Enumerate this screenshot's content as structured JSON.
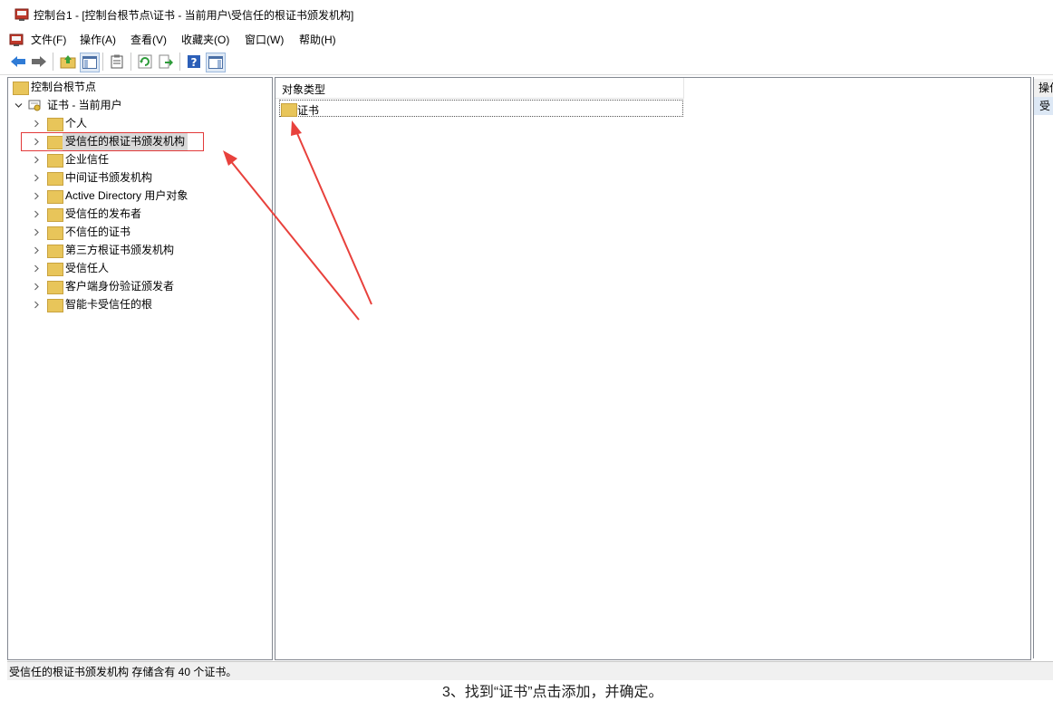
{
  "window": {
    "title": "控制台1 - [控制台根节点\\证书 - 当前用户\\受信任的根证书颁发机构]"
  },
  "menu": {
    "items": [
      "文件(F)",
      "操作(A)",
      "查看(V)",
      "收藏夹(O)",
      "窗口(W)",
      "帮助(H)"
    ]
  },
  "toolbar": {
    "icons": [
      "back-arrow-icon",
      "forward-arrow-icon",
      "up-folder-icon",
      "show-tree-icon",
      "properties-icon",
      "refresh-icon",
      "export-list-icon",
      "help-icon",
      "show-action-pane-icon"
    ]
  },
  "tree": {
    "root": "控制台根节点",
    "store": "证书 - 当前用户",
    "items": [
      "个人",
      "受信任的根证书颁发机构",
      "企业信任",
      "中间证书颁发机构",
      "Active Directory 用户对象",
      "受信任的发布者",
      "不信任的证书",
      "第三方根证书颁发机构",
      "受信任人",
      "客户端身份验证颁发者",
      "智能卡受信任的根"
    ],
    "selected_index": 1
  },
  "list": {
    "column_header": "对象类型",
    "rows": [
      "证书"
    ]
  },
  "action_pane": {
    "header": "操作",
    "item": "受"
  },
  "status": {
    "text": "受信任的根证书颁发机构 存储含有 40 个证书。"
  },
  "colors": {
    "highlight_box": "#e23a3a",
    "arrow": "#e8413c",
    "selection": "#d9d9d9",
    "folder": "#e8c55a",
    "action_header_bg": "#dde8f5"
  },
  "document_fragment": "3、找到“证书”点击添加，并确定。"
}
